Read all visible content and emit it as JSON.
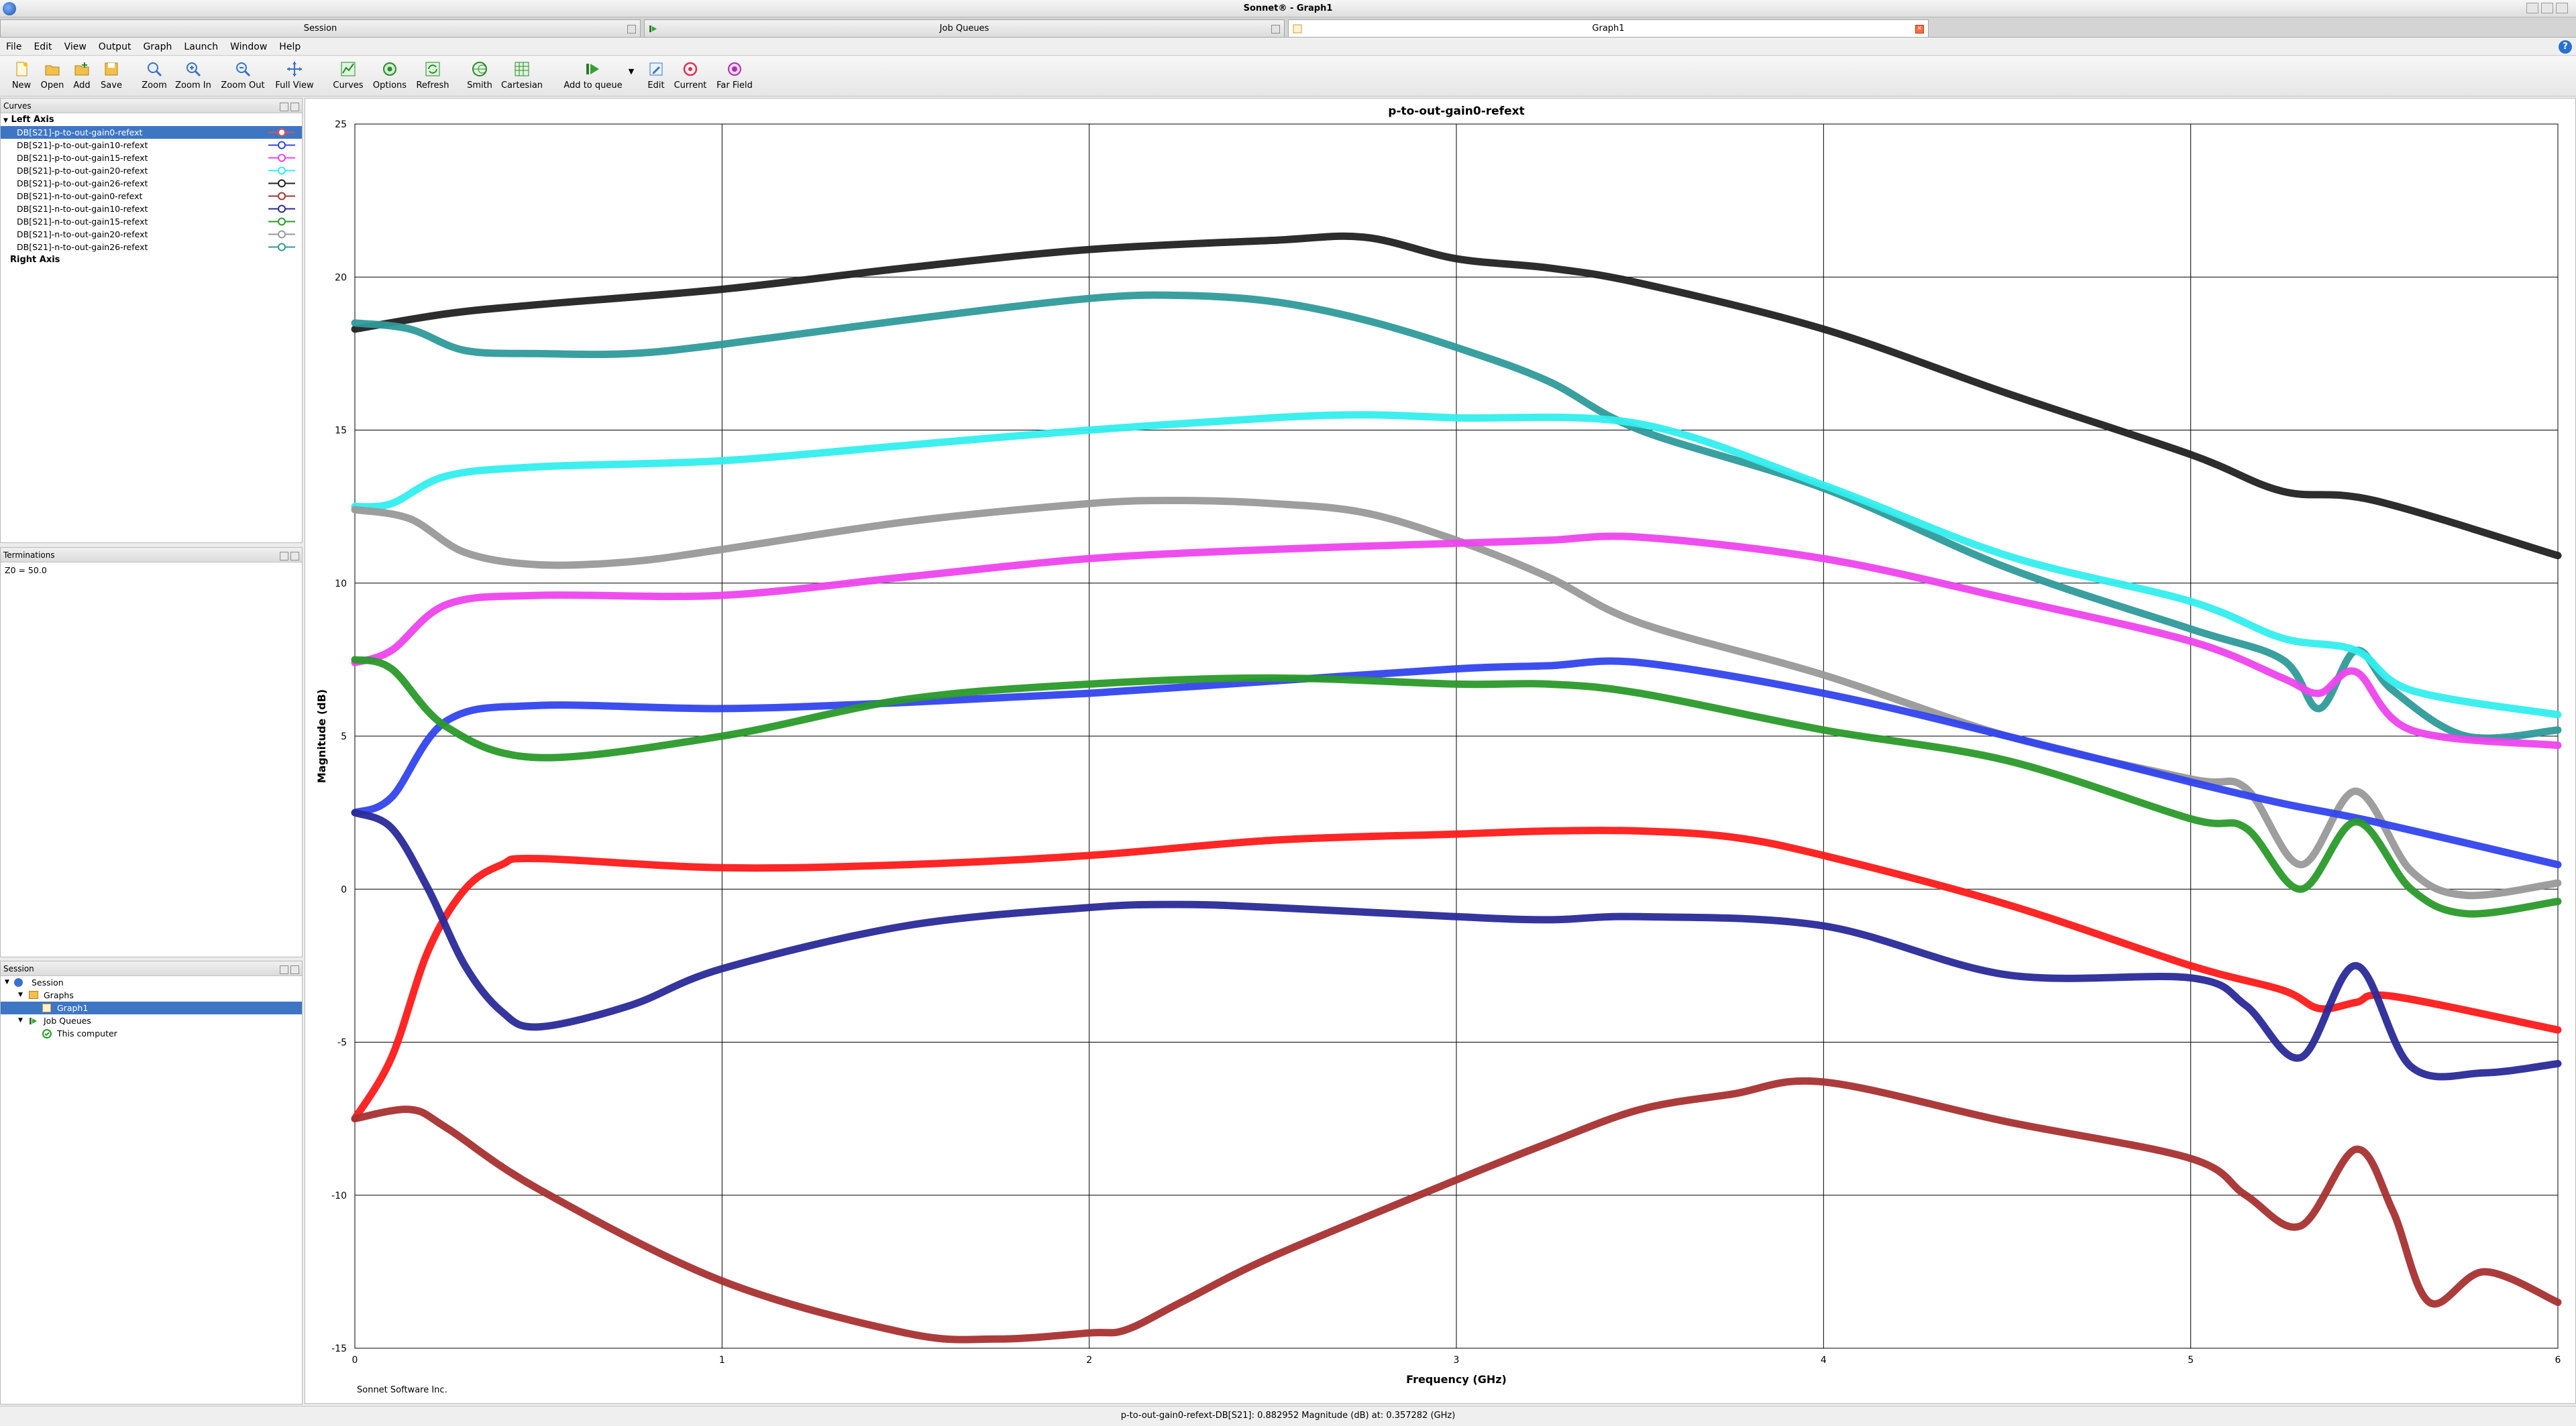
{
  "window": {
    "title": "Sonnet® - Graph1",
    "tabs": [
      {
        "label": "Session",
        "active": false
      },
      {
        "label": "Job Queues",
        "active": false
      },
      {
        "label": "Graph1",
        "active": true
      }
    ]
  },
  "menu": [
    "File",
    "Edit",
    "View",
    "Output",
    "Graph",
    "Launch",
    "Window",
    "Help"
  ],
  "toolbar": {
    "new": "New",
    "open": "Open",
    "add": "Add",
    "save": "Save",
    "zoom": "Zoom",
    "zoom_in": "Zoom In",
    "zoom_out": "Zoom Out",
    "full_view": "Full View",
    "curves": "Curves",
    "options": "Options",
    "refresh": "Refresh",
    "smith": "Smith",
    "cartesian": "Cartesian",
    "add_to_queue": "Add to queue",
    "edit": "Edit",
    "current": "Current",
    "far_field": "Far Field"
  },
  "curves_panel": {
    "title": "Curves",
    "left_axis_label": "Left Axis",
    "right_axis_label": "Right Axis",
    "items": [
      {
        "label": "DB[S21]-p-to-out-gain0-refext",
        "color": "#e05050",
        "selected": true
      },
      {
        "label": "DB[S21]-p-to-out-gain10-refext",
        "color": "#3344ee",
        "selected": false
      },
      {
        "label": "DB[S21]-p-to-out-gain15-refext",
        "color": "#ee44ee",
        "selected": false
      },
      {
        "label": "DB[S21]-p-to-out-gain20-refext",
        "color": "#33eeee",
        "selected": false
      },
      {
        "label": "DB[S21]-p-to-out-gain26-refext",
        "color": "#222222",
        "selected": false
      },
      {
        "label": "DB[S21]-n-to-out-gain0-refext",
        "color": "#a83232",
        "selected": false
      },
      {
        "label": "DB[S21]-n-to-out-gain10-refext",
        "color": "#2a2a99",
        "selected": false
      },
      {
        "label": "DB[S21]-n-to-out-gain15-refext",
        "color": "#2a9a2a",
        "selected": false
      },
      {
        "label": "DB[S21]-n-to-out-gain20-refext",
        "color": "#999999",
        "selected": false
      },
      {
        "label": "DB[S21]-n-to-out-gain26-refext",
        "color": "#2f9a9a",
        "selected": false
      }
    ]
  },
  "terminations_panel": {
    "title": "Terminations",
    "text": "Z0 = 50.0"
  },
  "session_panel": {
    "title": "Session",
    "tree": [
      {
        "label": "Session",
        "level": 0,
        "selected": false
      },
      {
        "label": "Graphs",
        "level": 1,
        "selected": false
      },
      {
        "label": "Graph1",
        "level": 2,
        "selected": true
      },
      {
        "label": "Job Queues",
        "level": 1,
        "selected": false
      },
      {
        "label": "This computer",
        "level": 2,
        "selected": false
      }
    ]
  },
  "graph_footer": "Sonnet Software Inc.",
  "status_text": "p-to-out-gain0-refext-DB[S21]: 0.882952 Magnitude (dB) at: 0.357282 (GHz)",
  "chart_data": {
    "type": "line",
    "title": "p-to-out-gain0-refext",
    "xlabel": "Frequency (GHz)",
    "ylabel": "Magnitude (dB)",
    "xlim": [
      0,
      6
    ],
    "ylim": [
      -15,
      25
    ],
    "xticks": [
      0,
      1,
      2,
      3,
      4,
      5,
      6
    ],
    "yticks": [
      -15,
      -10,
      -5,
      0,
      5,
      10,
      15,
      20,
      25
    ],
    "grid": true,
    "series": [
      {
        "name": "DB[S21]-p-to-out-gain26-refext",
        "color": "#222222",
        "x": [
          0,
          0.25,
          0.5,
          1,
          1.5,
          2,
          2.5,
          2.75,
          3,
          3.25,
          3.5,
          4,
          4.5,
          5,
          5.25,
          5.5,
          6
        ],
        "y": [
          18.3,
          18.8,
          19.1,
          19.6,
          20.3,
          20.9,
          21.2,
          21.3,
          20.6,
          20.3,
          19.8,
          18.3,
          16.2,
          14.2,
          13.0,
          12.7,
          10.9
        ]
      },
      {
        "name": "DB[S21]-n-to-out-gain26-refext",
        "color": "#2f9a9a",
        "x": [
          0,
          0.15,
          0.3,
          0.5,
          0.75,
          1,
          1.5,
          2,
          2.25,
          2.5,
          2.75,
          3,
          3.25,
          3.5,
          4,
          4.5,
          5,
          5.25,
          5.35,
          5.45,
          5.55,
          5.75,
          6
        ],
        "y": [
          18.5,
          18.3,
          17.6,
          17.5,
          17.5,
          17.8,
          18.6,
          19.3,
          19.4,
          19.2,
          18.6,
          17.7,
          16.6,
          15.0,
          13.1,
          10.5,
          8.5,
          7.5,
          5.9,
          7.8,
          6.5,
          5.0,
          5.2
        ]
      },
      {
        "name": "DB[S21]-p-to-out-gain20-refext",
        "color": "#33eeee",
        "x": [
          0,
          0.1,
          0.25,
          0.5,
          1,
          1.5,
          2,
          2.5,
          2.75,
          3,
          3.5,
          4,
          4.5,
          5,
          5.25,
          5.45,
          5.6,
          6
        ],
        "y": [
          12.5,
          12.6,
          13.5,
          13.8,
          14.0,
          14.5,
          15.0,
          15.4,
          15.5,
          15.4,
          15.2,
          13.2,
          10.9,
          9.4,
          8.2,
          7.8,
          6.5,
          5.7
        ]
      },
      {
        "name": "DB[S21]-n-to-out-gain20-refext",
        "color": "#999999",
        "x": [
          0,
          0.15,
          0.3,
          0.5,
          0.75,
          1,
          1.5,
          2,
          2.25,
          2.5,
          2.75,
          3,
          3.25,
          3.5,
          4,
          4.5,
          5,
          5.15,
          5.3,
          5.45,
          5.6,
          5.75,
          6
        ],
        "y": [
          12.4,
          12.1,
          11.0,
          10.6,
          10.7,
          11.1,
          12.0,
          12.6,
          12.7,
          12.6,
          12.3,
          11.4,
          10.2,
          8.7,
          7.0,
          5.0,
          3.6,
          3.3,
          0.8,
          3.2,
          0.6,
          -0.2,
          0.2
        ]
      },
      {
        "name": "DB[S21]-p-to-out-gain15-refext",
        "color": "#ee44ee",
        "x": [
          0,
          0.1,
          0.25,
          0.5,
          1,
          1.5,
          2,
          2.5,
          3,
          3.25,
          3.5,
          4,
          4.5,
          5,
          5.25,
          5.35,
          5.45,
          5.6,
          6
        ],
        "y": [
          7.4,
          7.8,
          9.3,
          9.6,
          9.6,
          10.2,
          10.8,
          11.1,
          11.3,
          11.4,
          11.5,
          10.8,
          9.5,
          8.1,
          6.9,
          6.4,
          7.1,
          5.2,
          4.7
        ]
      },
      {
        "name": "DB[S21]-p-to-out-gain10-refext",
        "color": "#3344ee",
        "x": [
          0,
          0.1,
          0.25,
          0.5,
          1,
          1.5,
          2,
          2.5,
          3,
          3.25,
          3.5,
          4,
          4.5,
          5,
          5.25,
          5.5,
          6
        ],
        "y": [
          2.5,
          3.0,
          5.5,
          6.0,
          5.9,
          6.1,
          6.4,
          6.8,
          7.2,
          7.3,
          7.4,
          6.4,
          5.0,
          3.5,
          2.8,
          2.2,
          0.8
        ]
      },
      {
        "name": "DB[S21]-n-to-out-gain15-refext",
        "color": "#2a9a2a",
        "x": [
          0,
          0.1,
          0.25,
          0.5,
          1,
          1.5,
          2,
          2.5,
          3,
          3.25,
          3.5,
          4,
          4.5,
          5,
          5.15,
          5.3,
          5.45,
          5.6,
          5.75,
          6
        ],
        "y": [
          7.5,
          7.2,
          5.3,
          4.3,
          5.0,
          6.2,
          6.7,
          6.9,
          6.7,
          6.7,
          6.4,
          5.2,
          4.2,
          2.3,
          2.0,
          0.0,
          2.2,
          0.0,
          -0.8,
          -0.4
        ]
      },
      {
        "name": "DB[S21]-p-to-out-gain0-refext",
        "color": "#ff1a1a",
        "x": [
          0,
          0.1,
          0.2,
          0.3,
          0.4,
          0.5,
          1,
          1.5,
          2,
          2.5,
          3,
          3.25,
          3.5,
          3.75,
          4,
          4.5,
          5,
          5.25,
          5.35,
          5.45,
          5.55,
          6
        ],
        "y": [
          -7.5,
          -5.5,
          -2.0,
          0.0,
          0.8,
          1.0,
          0.7,
          0.8,
          1.1,
          1.6,
          1.8,
          1.9,
          1.9,
          1.7,
          1.1,
          -0.5,
          -2.5,
          -3.3,
          -3.9,
          -3.7,
          -3.5,
          -4.6
        ]
      },
      {
        "name": "DB[S21]-n-to-out-gain10-refext",
        "color": "#2a2a99",
        "x": [
          0,
          0.1,
          0.2,
          0.3,
          0.4,
          0.5,
          0.75,
          1,
          1.5,
          2,
          2.25,
          2.5,
          3,
          3.25,
          3.5,
          4,
          4.5,
          5,
          5.15,
          5.3,
          5.45,
          5.6,
          5.8,
          6
        ],
        "y": [
          2.5,
          2.0,
          0.0,
          -2.5,
          -4.0,
          -4.5,
          -3.8,
          -2.6,
          -1.2,
          -0.6,
          -0.5,
          -0.6,
          -0.9,
          -1.0,
          -0.9,
          -1.2,
          -2.8,
          -2.9,
          -3.8,
          -5.5,
          -2.5,
          -5.8,
          -6.0,
          -5.7
        ]
      },
      {
        "name": "DB[S21]-n-to-out-gain0-refext",
        "color": "#a83232",
        "x": [
          0,
          0.15,
          0.25,
          0.5,
          1,
          1.5,
          1.75,
          2,
          2.1,
          2.25,
          2.5,
          3,
          3.25,
          3.5,
          3.75,
          4,
          4.5,
          5,
          5.15,
          5.3,
          5.45,
          5.55,
          5.65,
          5.8,
          6
        ],
        "y": [
          -7.5,
          -7.2,
          -7.8,
          -9.8,
          -12.8,
          -14.5,
          -14.7,
          -14.5,
          -14.4,
          -13.5,
          -12.0,
          -9.5,
          -8.3,
          -7.2,
          -6.7,
          -6.3,
          -7.6,
          -8.8,
          -10.0,
          -11.0,
          -8.5,
          -10.5,
          -13.5,
          -12.5,
          -13.5
        ]
      }
    ]
  }
}
